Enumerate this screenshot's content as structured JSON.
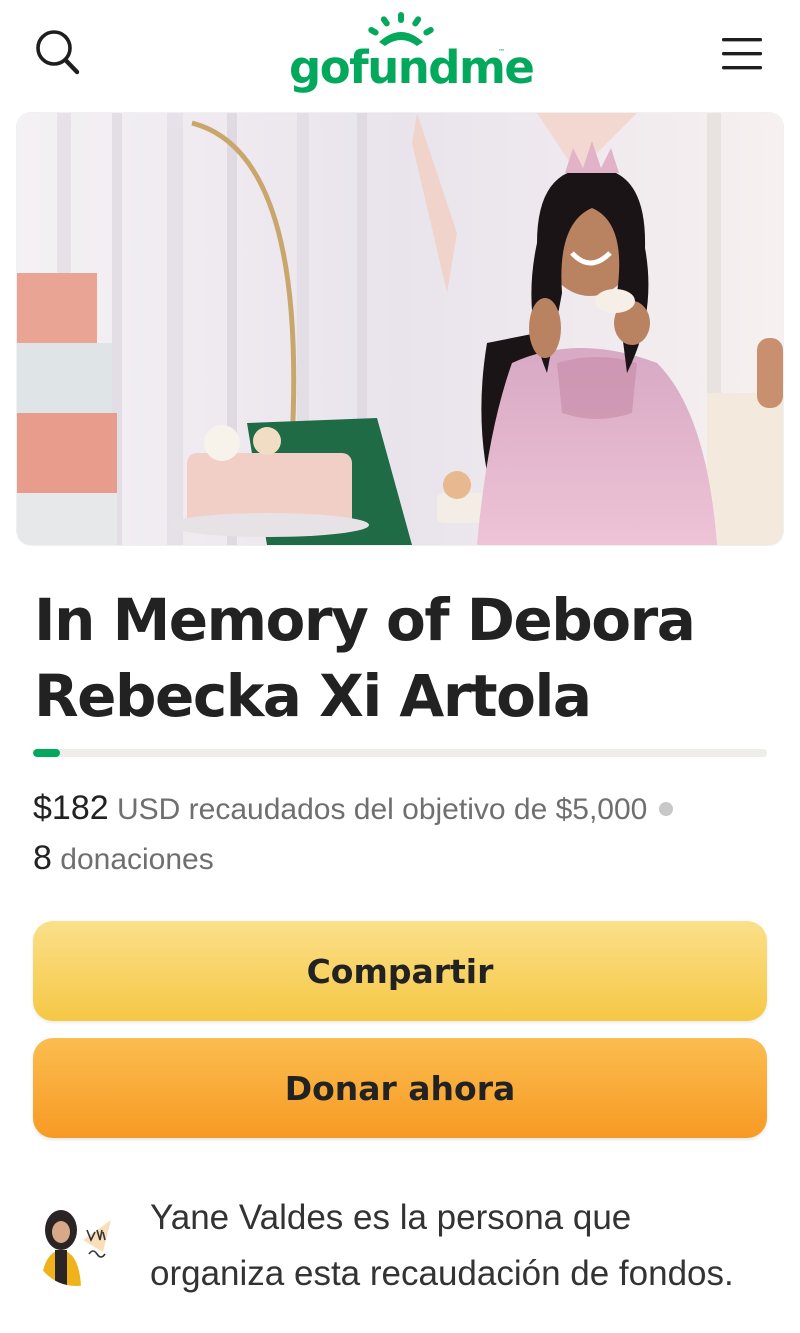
{
  "header": {
    "logo_text": "gofundme",
    "logo_tm": "™",
    "brand_color": "#02a95c",
    "search_icon": "search-icon",
    "menu_icon": "hamburger-menu-icon"
  },
  "campaign": {
    "title": "In Memory of Debora Rebecka Xi Artola",
    "raised_amount": "$182",
    "raised_text": "USD recaudados del objetivo de $5,000",
    "donation_count": "8",
    "donation_label": "donaciones",
    "progress_fraction": 0.0364
  },
  "buttons": {
    "share_label": "Compartir",
    "donate_label": "Donar ahora"
  },
  "organizer": {
    "text": "Yane Valdes es la persona que organiza esta recaudación de fondos."
  }
}
